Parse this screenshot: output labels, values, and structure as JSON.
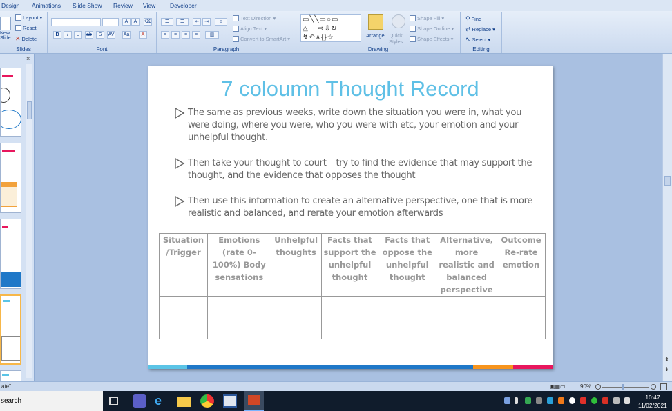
{
  "tabs": [
    "Design",
    "Animations",
    "Slide Show",
    "Review",
    "View",
    "Developer"
  ],
  "ribbon": {
    "slides": {
      "new_label_1": "New",
      "new_label_2": "Slide",
      "layout": "Layout",
      "reset": "Reset",
      "delete": "Delete",
      "group": "Slides"
    },
    "font": {
      "group": "Font"
    },
    "paragraph": {
      "text_direction": "Text Direction",
      "align_text": "Align Text",
      "convert_smartart": "Convert to SmartArt",
      "group": "Paragraph"
    },
    "drawing": {
      "arrange": "Arrange",
      "quick_1": "Quick",
      "quick_2": "Styles",
      "shape_fill": "Shape Fill",
      "shape_outline": "Shape Outline",
      "shape_effects": "Shape Effects",
      "group": "Drawing"
    },
    "editing": {
      "find": "Find",
      "replace": "Replace",
      "select": "Select",
      "group": "Editing"
    }
  },
  "slide": {
    "title": "7 coloumn Thought Record",
    "bullets": [
      "The same as previous weeks, write down the situation you were in, what you were doing, where you were, who you were with etc, your emotion and your unhelpful thought.",
      "Then take your thought to court – try to find the evidence that may support the thought, and the evidence that opposes the thought",
      "Then use this information to create an alternative perspective, one that is more realistic and balanced, and rerate your emotion afterwards"
    ],
    "table_headers": [
      "Situation /Trigger",
      "Emotions (rate 0-100%) Body sensations",
      "Unhelpful thoughts",
      "Facts that support the unhelpful thought",
      "Facts that oppose the unhelpful thought",
      "Alternative, more realistic and balanced perspective",
      "Outcome Re-rate emotion"
    ],
    "bar_colors": [
      "#5bc4e6",
      "#1f78c8",
      "#f7941d",
      "#e8175d"
    ]
  },
  "status": {
    "left": "ate\"",
    "zoom": "90%"
  },
  "taskbar": {
    "search": "search",
    "time": "10:47",
    "date": "11/02/2021"
  }
}
